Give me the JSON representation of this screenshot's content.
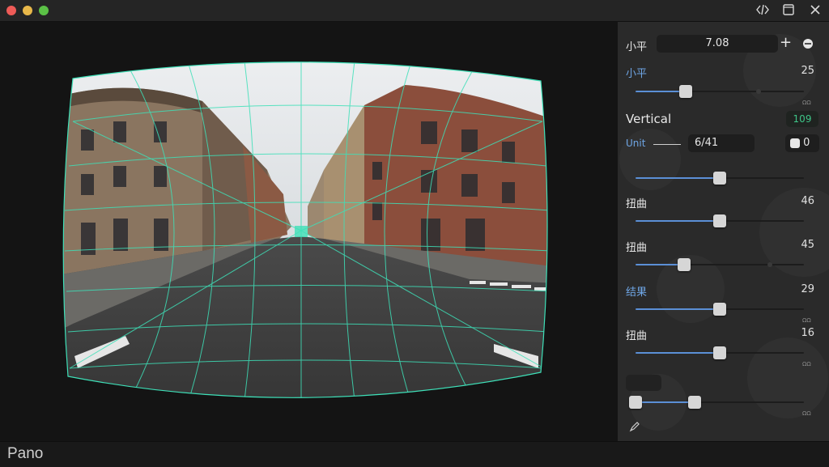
{
  "window": {
    "buttons": [
      "close",
      "minimize",
      "zoom"
    ],
    "toolbar_icons": [
      "code-icon",
      "window-icon",
      "close-icon"
    ]
  },
  "footer": {
    "app_name": "Pano"
  },
  "panel": {
    "top_field": {
      "label": "小平",
      "value": "7.08",
      "add_icon": "+",
      "link_icon": "link-icon"
    },
    "sliders": [
      {
        "id": "s1",
        "label": "小平",
        "label_color": "blue",
        "value": "25",
        "fraction": 0.3,
        "secondary": 0.73,
        "hint": "ΩΩ"
      },
      {
        "id": "vertical",
        "label": "Vertical",
        "badge": "109"
      },
      {
        "id": "unit",
        "label": "Unit",
        "field": "6/41",
        "toggle": "0"
      },
      {
        "id": "s3",
        "fraction": 0.5
      },
      {
        "id": "s4",
        "label": "扭曲",
        "value": "46",
        "fraction": 0.5
      },
      {
        "id": "s5",
        "label": "扭曲",
        "value": "45",
        "fraction": 0.29,
        "secondary": 0.8
      },
      {
        "id": "s6",
        "label": "结果",
        "label_color": "blue",
        "value": "29",
        "fraction": 0.5,
        "hint": "ΩΩ"
      },
      {
        "id": "s7",
        "label": "扭曲",
        "value": "16",
        "fraction": 0.5,
        "hint": "ΩΩ"
      },
      {
        "id": "s8",
        "fraction_low": 0.0,
        "fraction_high": 0.35,
        "hint": "ΩΩ"
      }
    ],
    "bottom_icon": "pen-icon",
    "hints": [
      "ΩΩ",
      "ΩΩ",
      "ΩΩ",
      "ΩΩ"
    ]
  },
  "colors": {
    "grid": "#3ee0b8",
    "slider_fill": "#5b8fd6",
    "badge_text": "#3ec487",
    "label_blue": "#6fa6e6"
  }
}
